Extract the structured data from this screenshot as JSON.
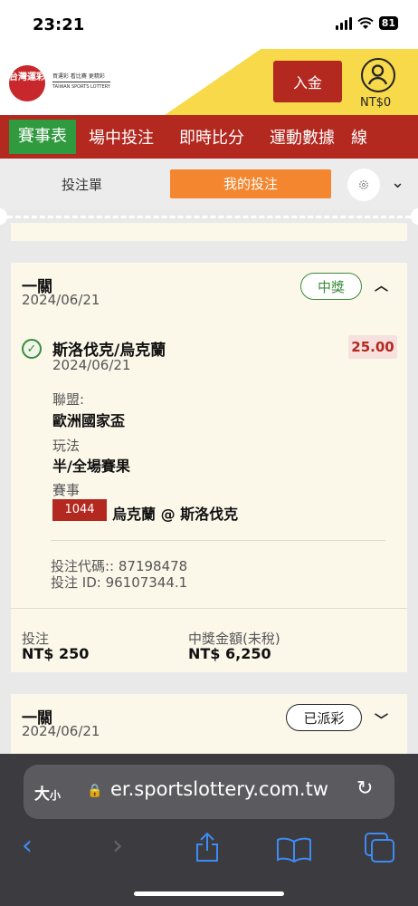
{
  "status_bar": {
    "time": "23:21",
    "battery": "81"
  },
  "header": {
    "logo_mark": "台灣運彩",
    "logo_line1": "買運彩 看比賽 更精彩",
    "logo_line2": "TAIWAN SPORTS LOTTERY",
    "deposit_label": "入金",
    "balance": "NT$0"
  },
  "nav": {
    "items": [
      "賽事表",
      "場中投注",
      "即時比分",
      "運動數據",
      "線"
    ]
  },
  "bet_tabs": {
    "betslip": "投注單",
    "my_bets": "我的投注"
  },
  "bet1": {
    "type": "一關",
    "date": "2024/06/21",
    "status": "中獎",
    "selection": "斯洛伐克/烏克蘭",
    "selection_date": "2024/06/21",
    "odds": "25.00",
    "league_label": "聯盟:",
    "league": "歐洲國家盃",
    "market_label": "玩法",
    "market": "半/全場賽果",
    "event_label": "賽事",
    "event_code": "1044",
    "event_name": "烏克蘭 @ 斯洛伐克",
    "bet_code": "投注代碼:: 87198478",
    "bet_id": "投注 ID: 96107344.1",
    "stake_label": "投注",
    "stake": "NT$ 250",
    "payout_label": "中獎金額(未稅)",
    "payout": "NT$ 6,250"
  },
  "bet2": {
    "type": "一關",
    "date": "2024/06/21",
    "status": "已派彩"
  },
  "browser": {
    "text_size": "大",
    "text_size_small": "小",
    "url": "er.sportslottery.com.tw"
  },
  "colors": {
    "brand_red": "#b3281f",
    "active_green": "#2f9a3e",
    "tab_orange": "#f3862e",
    "win_green": "#3d8a3b"
  }
}
